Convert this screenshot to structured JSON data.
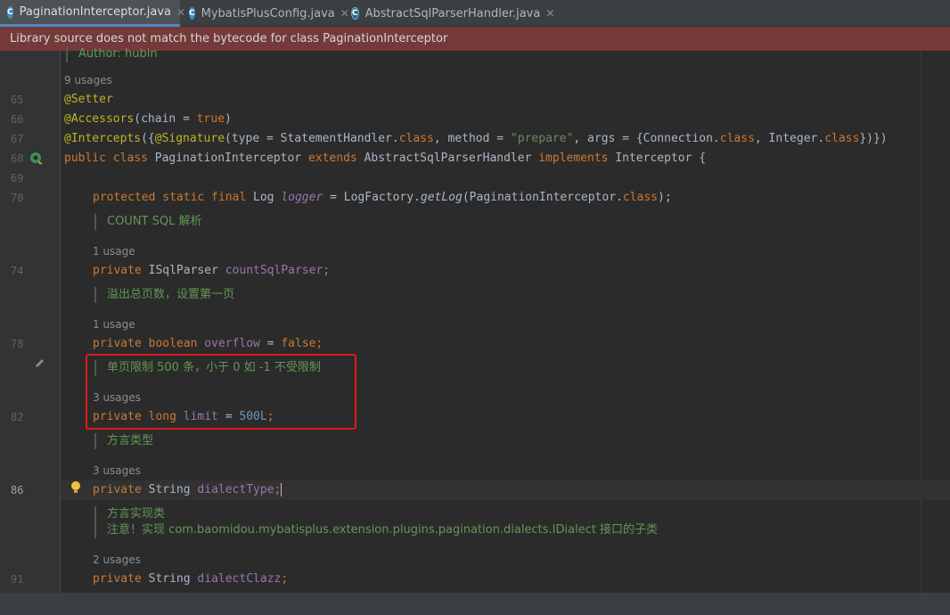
{
  "tabs": [
    {
      "label": "PaginationInterceptor.java",
      "icon": "class-icon",
      "active": true
    },
    {
      "label": "MybatisPlusConfig.java",
      "icon": "class-icon",
      "active": false
    },
    {
      "label": "AbstractSqlParserHandler.java",
      "icon": "abstract-class-icon",
      "active": false
    }
  ],
  "banner": {
    "text": "Library source does not match the bytecode for class PaginationInterceptor"
  },
  "header_doc": {
    "author": "Author: hubin"
  },
  "line_numbers": {
    "l65": "65",
    "l66": "66",
    "l67": "67",
    "l68": "68",
    "l69": "69",
    "l70": "70",
    "l74": "74",
    "l78": "78",
    "l82": "82",
    "l86": "86",
    "l91": "91"
  },
  "usages": {
    "class": "9 usages",
    "countSqlParser": "1 usage",
    "overflow": "1 usage",
    "limit": "3 usages",
    "dialectType": "3 usages",
    "dialectClazz": "2 usages"
  },
  "docs": {
    "countSql": "COUNT SQL 解析",
    "overflow": "溢出总页数，设置第一页",
    "limit": "单页限制 500 条，小于 0 如 -1 不受限制",
    "dialectType": "方言类型",
    "dialectClazz_1": "方言实现类",
    "dialectClazz_2": "注意！实现 com.baomidou.mybatisplus.extension.plugins.pagination.dialects.IDialect 接口的子类"
  },
  "code": {
    "l65": {
      "a": "@Setter"
    },
    "l66": {
      "a": "@Accessors",
      "b": "(chain = ",
      "c": "true",
      "d": ")"
    },
    "l67": {
      "a": "@Intercepts",
      "b": "({",
      "c": "@Signature",
      "d": "(type = StatementHandler.",
      "e": "class",
      "f": ", method = ",
      "g": "\"prepare\"",
      "h": ", args = {Connection.",
      "i": "class",
      "j": ", Integer.",
      "k": "class",
      "l": "})})"
    },
    "l68": {
      "a": "public class ",
      "b": "PaginationInterceptor ",
      "c": "extends ",
      "d": "AbstractSqlParserHandler ",
      "e": "implements ",
      "f": "Interceptor {"
    },
    "l70": {
      "a": "protected static final ",
      "b": "Log ",
      "c": "logger",
      "d": " = LogFactory.",
      "e": "getLog",
      "f": "(PaginationInterceptor.",
      "g": "class",
      "h": ");"
    },
    "l74": {
      "a": "private ",
      "b": "ISqlParser ",
      "c": "countSqlParser",
      "d": ";"
    },
    "l78": {
      "a": "private boolean ",
      "b": "overflow",
      "c": " = ",
      "d": "false",
      "e": ";"
    },
    "l82": {
      "a": "private long ",
      "b": "limit",
      "c": " = ",
      "d": "500L",
      "e": ";"
    },
    "l86": {
      "a": "private ",
      "b": "String ",
      "c": "dialectType",
      "d": ";"
    },
    "l91": {
      "a": "private ",
      "b": "String ",
      "c": "dialectClazz",
      "d": ";"
    }
  },
  "colors": {
    "keyword": "#cc7832",
    "annotation": "#bbb529",
    "field": "#9876aa",
    "string": "#6a8759",
    "number": "#6897bb",
    "doc": "#629755",
    "highlight_box": "#e0191b"
  }
}
